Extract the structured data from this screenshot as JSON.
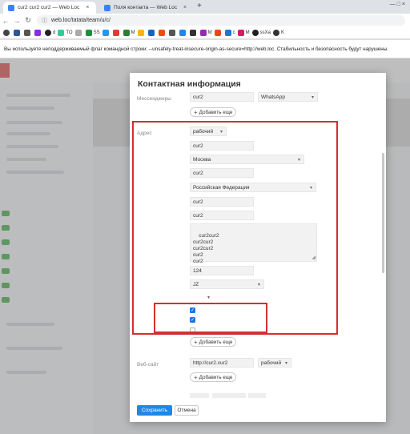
{
  "browser": {
    "tabs": [
      {
        "title": "cur2 cur2 cur2 — Web Loc",
        "close": "×"
      },
      {
        "title": "Поля контакта — Web Loc",
        "close": "×"
      }
    ],
    "new_tab": "+",
    "window_controls": "— □ ×",
    "url": "web.loc/tatata/team/u/c/",
    "bookmarks": [
      "d",
      "TO",
      "SS",
      "M",
      "M",
      "c",
      "M",
      "ssXa",
      "K"
    ],
    "warning": "Вы используете неподдерживаемый флаг командной строки: --unsafely-treat-insecure-origin-as-secure=http://web.loc. Стабильность и безопасность будут нарушены."
  },
  "modal": {
    "title": "Контактная информация",
    "messengers": {
      "label": "Мессенджеры",
      "value": "cur2",
      "type": "WhatsApp",
      "add": "Добавить еще"
    },
    "address": {
      "label": "Адрес",
      "type": "рабочий",
      "field1": "cur2",
      "city_select": "Москва",
      "field3": "cur2",
      "country_select": "Российская Федерация",
      "field5": "cur2",
      "field6": "cur2",
      "textarea": "cur2cur2\ncur2cur2\ncur2cur2\ncur2\ncur2",
      "zip": "124",
      "tz_select": "JZ",
      "empty_select": "",
      "checkboxes": [
        true,
        true,
        false
      ],
      "add": "Добавить еще"
    },
    "website": {
      "label": "Веб-сайт",
      "value": "http://cur2.cur2",
      "type": "рабочий",
      "add": "Добавить еще"
    },
    "buttons": {
      "save": "Сохранить",
      "cancel": "Отмена"
    }
  },
  "colors": {
    "accent": "#1e88e5",
    "highlight_border": "#d32f2f",
    "checkbox_checked": "#1a73e8"
  }
}
